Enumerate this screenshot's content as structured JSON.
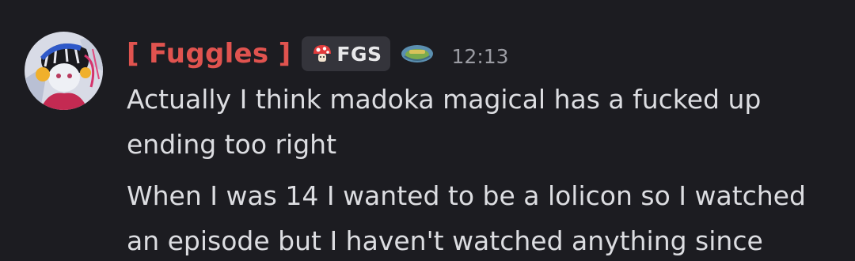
{
  "message": {
    "author": "[ Fuggles ]",
    "author_color": "#e0534f",
    "tag": {
      "icon": "mushroom-icon",
      "label": "FGS"
    },
    "badge_icon": "server-badge-icon",
    "timestamp": "12:13",
    "lines": [
      "Actually I think madoka magical has a fucked up",
      "ending too right",
      "When I was 14 I wanted to be a lolicon so I watched",
      "an episode but I haven't watched anything since"
    ]
  },
  "colors": {
    "background": "#1c1c21",
    "text": "#dcdde1",
    "timestamp": "#9b9ca3",
    "tag_background": "#34343b"
  }
}
